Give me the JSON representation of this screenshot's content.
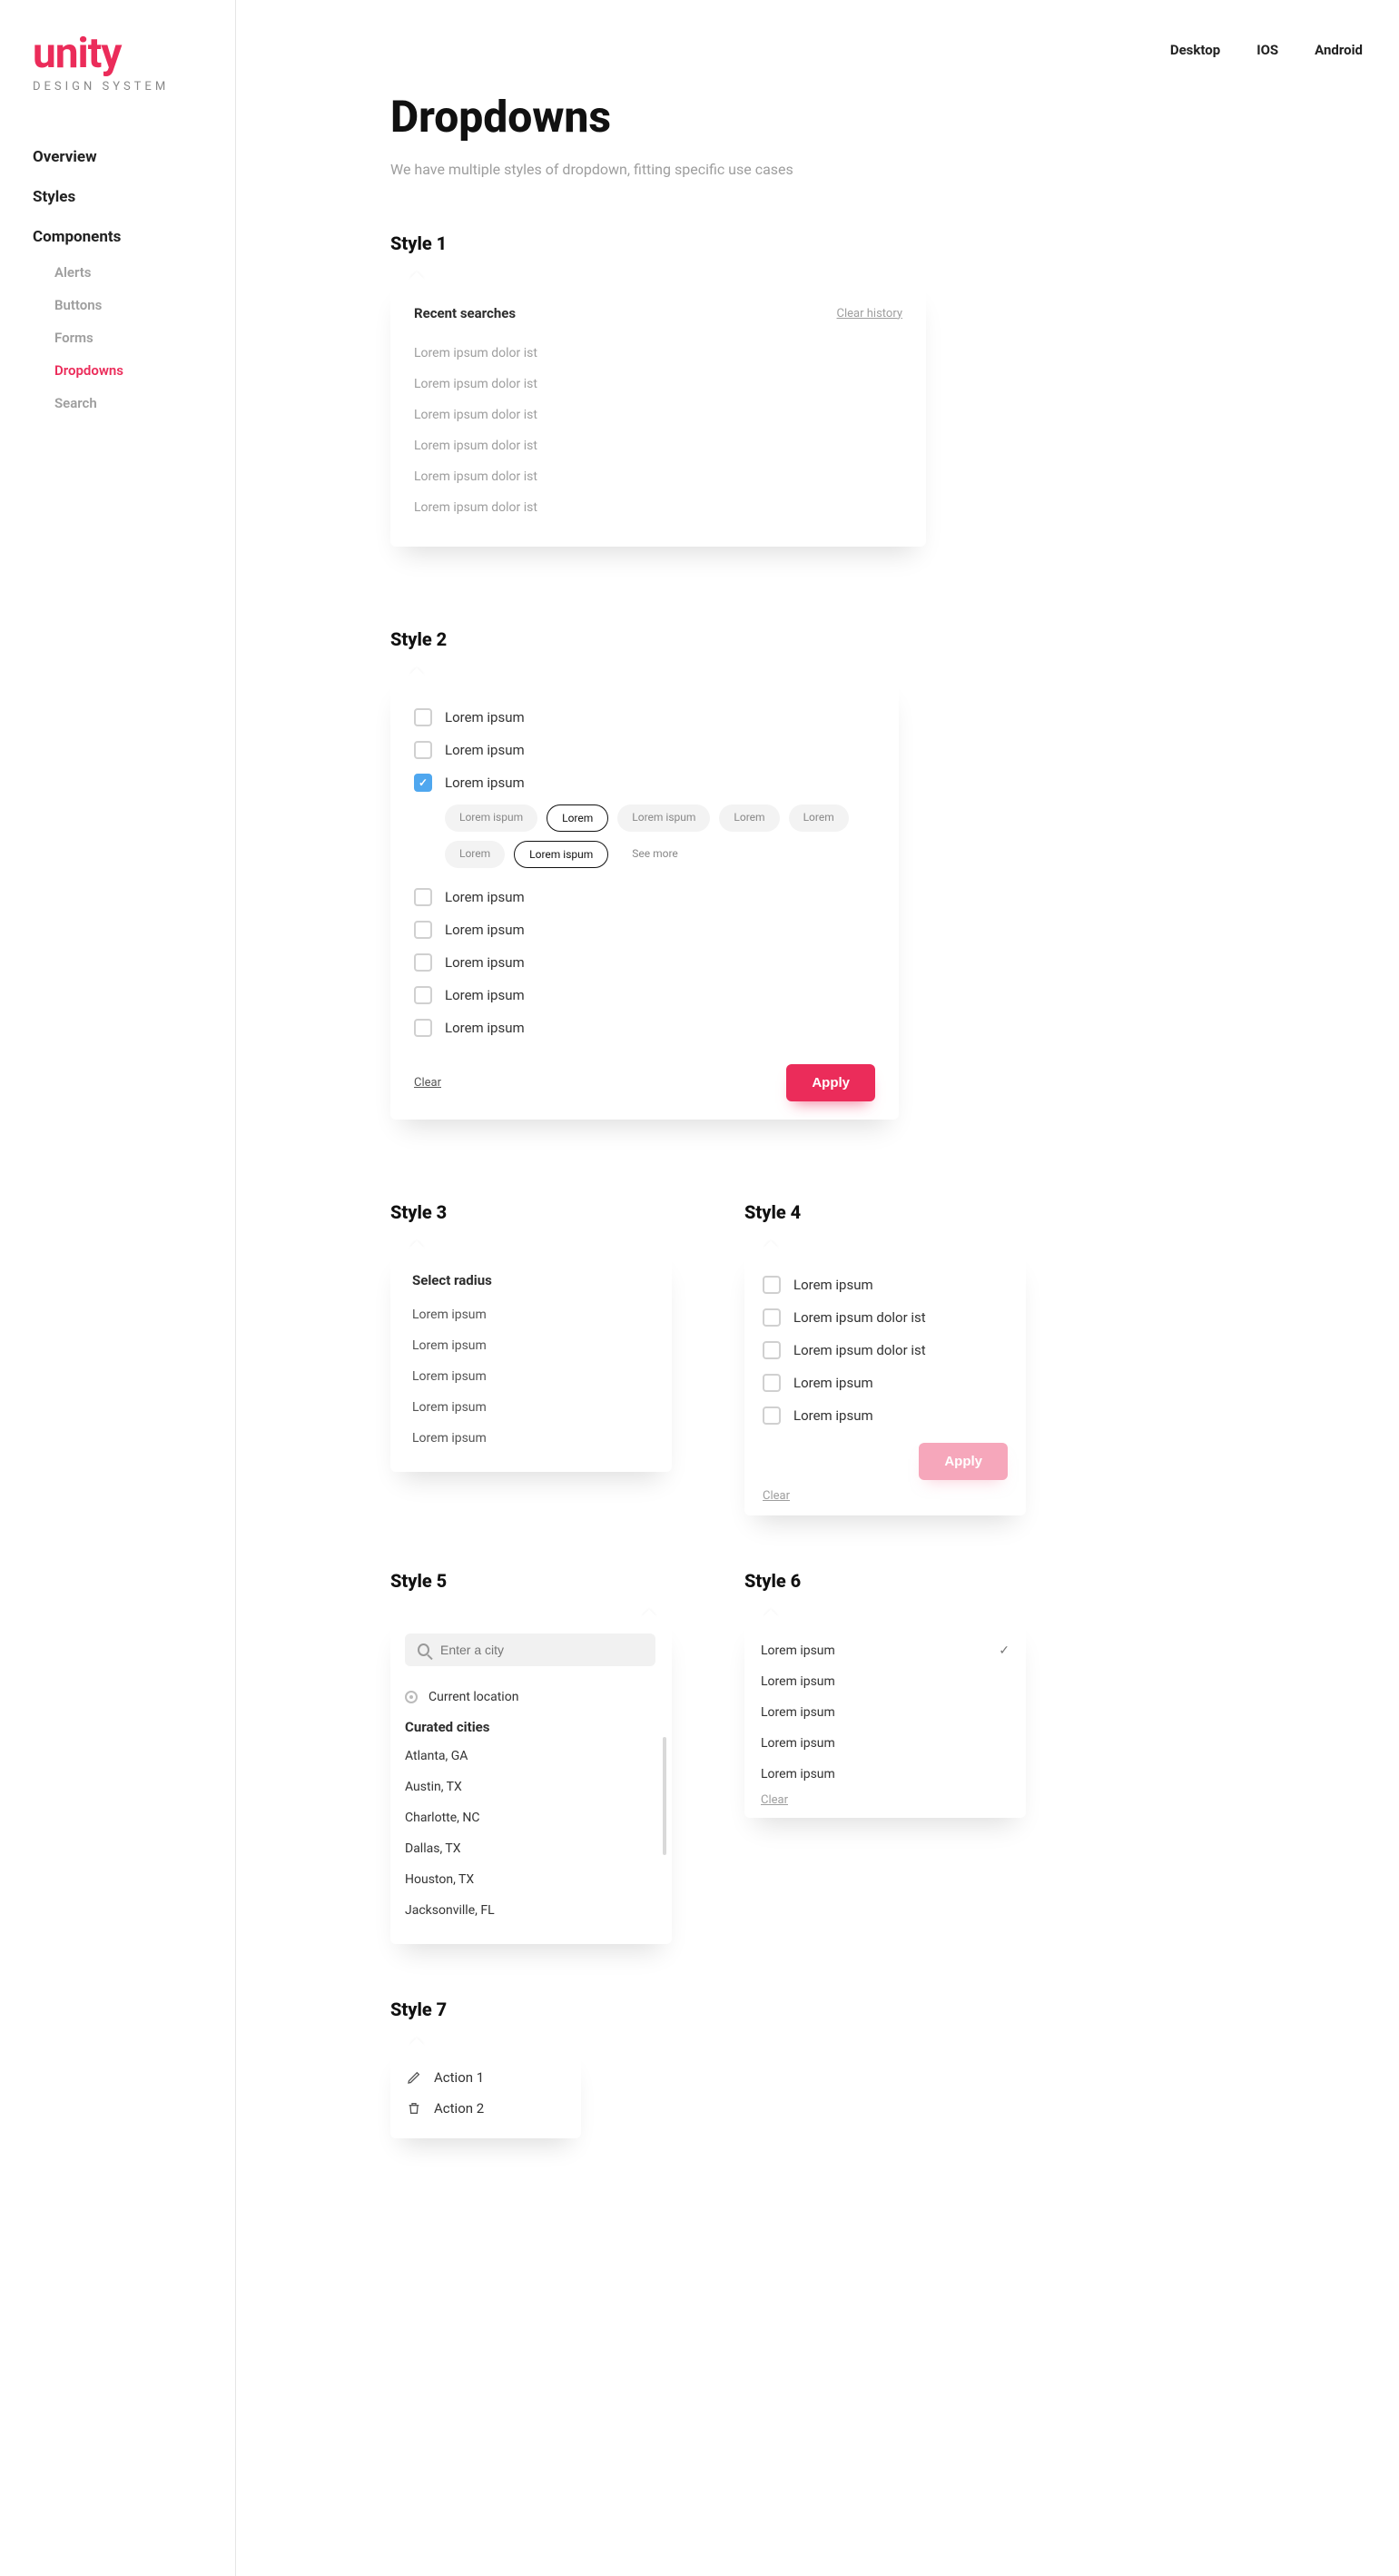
{
  "brand": {
    "name": "unity",
    "sub": "DESIGN SYSTEM"
  },
  "top_tabs": {
    "desktop": "Desktop",
    "ios": "IOS",
    "android": "Android"
  },
  "sidebar": {
    "overview": "Overview",
    "styles": "Styles",
    "components": "Components",
    "sub": {
      "alerts": "Alerts",
      "buttons": "Buttons",
      "forms": "Forms",
      "dropdowns": "Dropdowns",
      "search": "Search"
    }
  },
  "page": {
    "title": "Dropdowns",
    "subtitle": "We have multiple styles of dropdown, fitting specific use cases"
  },
  "style1": {
    "heading": "Style 1",
    "title": "Recent searches",
    "clear": "Clear history",
    "items": [
      "Lorem ipsum dolor ist",
      "Lorem ipsum dolor ist",
      "Lorem ipsum dolor ist",
      "Lorem ipsum dolor ist",
      "Lorem ipsum dolor ist",
      "Lorem ipsum dolor ist"
    ]
  },
  "style2": {
    "heading": "Style 2",
    "items_top": [
      "Lorem ipsum",
      "Lorem ipsum"
    ],
    "checked_label": "Lorem ipsum",
    "chips": [
      {
        "label": "Lorem ispum",
        "sel": false
      },
      {
        "label": "Lorem",
        "sel": true
      },
      {
        "label": "Lorem ispum",
        "sel": false
      },
      {
        "label": "Lorem",
        "sel": false
      },
      {
        "label": "Lorem",
        "sel": false
      },
      {
        "label": "Lorem",
        "sel": false
      },
      {
        "label": "Lorem ispum",
        "sel": true
      }
    ],
    "see_more": "See more",
    "items_bottom": [
      "Lorem ipsum",
      "Lorem ipsum",
      "Lorem ipsum",
      "Lorem ipsum",
      "Lorem ipsum"
    ],
    "clear": "Clear",
    "apply": "Apply"
  },
  "style3": {
    "heading": "Style 3",
    "title": "Select radius",
    "items": [
      "Lorem ipsum",
      "Lorem ipsum",
      "Lorem ipsum",
      "Lorem ipsum",
      "Lorem ipsum"
    ]
  },
  "style4": {
    "heading": "Style 4",
    "items": [
      "Lorem ipsum",
      "Lorem ipsum dolor ist",
      "Lorem ipsum dolor ist",
      "Lorem ipsum",
      "Lorem ipsum"
    ],
    "apply": "Apply",
    "clear": "Clear"
  },
  "style5": {
    "heading": "Style 5",
    "placeholder": "Enter a city",
    "current": "Current location",
    "curated": "Curated cities",
    "cities": [
      "Atlanta, GA",
      "Austin, TX",
      "Charlotte, NC",
      "Dallas, TX",
      "Houston, TX",
      "Jacksonville, FL"
    ]
  },
  "style6": {
    "heading": "Style 6",
    "items": [
      "Lorem ipsum",
      "Lorem ipsum",
      "Lorem ipsum",
      "Lorem ipsum",
      "Lorem ipsum"
    ],
    "clear": "Clear"
  },
  "style7": {
    "heading": "Style 7",
    "action1": "Action 1",
    "action2": "Action 2"
  }
}
